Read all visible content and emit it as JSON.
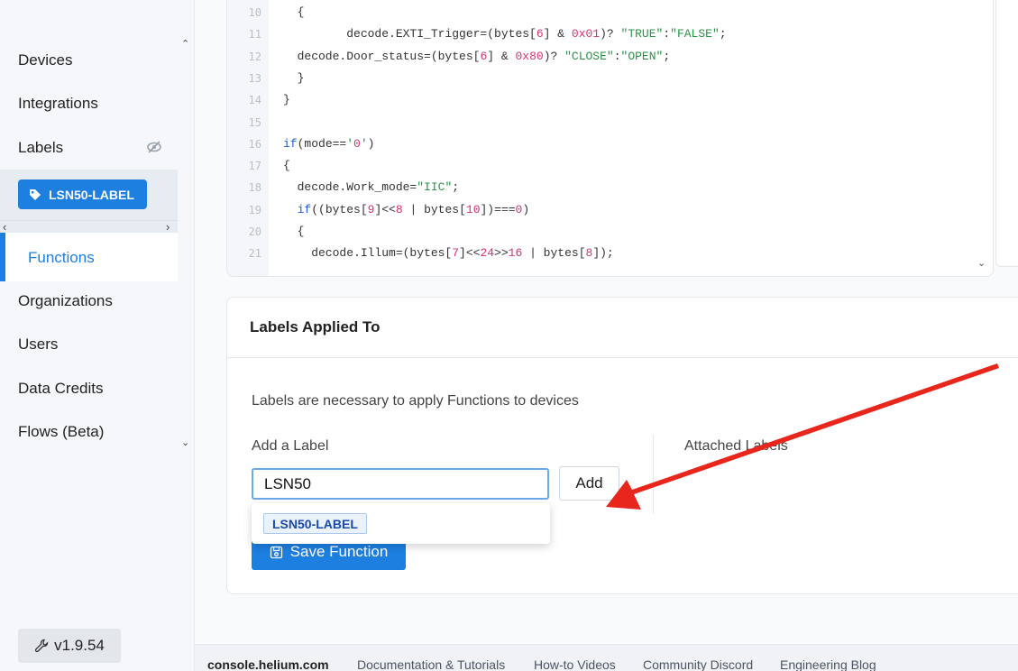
{
  "sidebar": {
    "items": [
      {
        "label": "Devices"
      },
      {
        "label": "Integrations"
      },
      {
        "label": "Labels"
      },
      {
        "label": "Functions"
      },
      {
        "label": "Organizations"
      },
      {
        "label": "Users"
      },
      {
        "label": "Data Credits"
      },
      {
        "label": "Flows (Beta)"
      }
    ],
    "active_label_chip": "LSN50-LABEL",
    "version": "v1.9.54"
  },
  "code": {
    "lines": [
      {
        "n": "10",
        "text": "  {"
      },
      {
        "n": "11",
        "text": "         decode.EXTI_Trigger=(bytes[6] & 0x01)? \"TRUE\":\"FALSE\";"
      },
      {
        "n": "12",
        "text": "  decode.Door_status=(bytes[6] & 0x80)? \"CLOSE\":\"OPEN\";"
      },
      {
        "n": "13",
        "text": "  }"
      },
      {
        "n": "14",
        "text": "}"
      },
      {
        "n": "15",
        "text": ""
      },
      {
        "n": "16",
        "text": "if(mode=='0')"
      },
      {
        "n": "17",
        "text": "{"
      },
      {
        "n": "18",
        "text": "  decode.Work_mode=\"IIC\";"
      },
      {
        "n": "19",
        "text": "  if((bytes[9]<<8 | bytes[10])===0)"
      },
      {
        "n": "20",
        "text": "  {"
      },
      {
        "n": "21",
        "text": "    decode.Illum=(bytes[7]<<24>>16 | bytes[8]);"
      }
    ]
  },
  "labels_panel": {
    "title": "Labels Applied To",
    "description": "Labels are necessary to apply Functions to devices",
    "add_label_title": "Add a Label",
    "attached_title": "Attached Labels",
    "input_value": "LSN50",
    "add_button": "Add",
    "suggestion": "LSN50-LABEL",
    "save_button": "Save Function"
  },
  "footer": {
    "domain": "console.helium.com",
    "links": [
      "Documentation & Tutorials",
      "How-to Videos",
      "Community Discord",
      "Engineering Blog"
    ]
  },
  "colors": {
    "accent": "#1d7fe0",
    "annotation_arrow": "#e8261c"
  }
}
